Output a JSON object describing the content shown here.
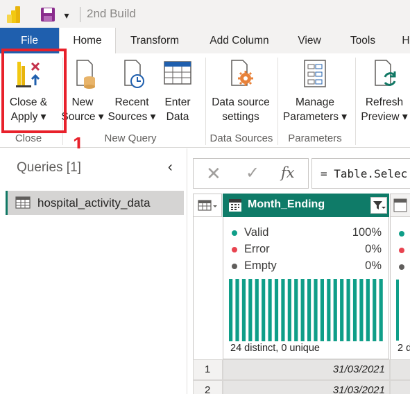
{
  "titlebar": {
    "title": "2nd Build",
    "dropdown_glyph": "▾",
    "icons": [
      "powerbi-logo-icon",
      "save-icon",
      "chevron-down-icon"
    ]
  },
  "tabs": [
    {
      "label": "File"
    },
    {
      "label": "Home"
    },
    {
      "label": "Transform"
    },
    {
      "label": "Add Column"
    },
    {
      "label": "View"
    },
    {
      "label": "Tools"
    },
    {
      "label": "H"
    }
  ],
  "ribbon": {
    "close_apply": {
      "line1": "Close &",
      "line2": "Apply ▾"
    },
    "new_source": {
      "line1": "New",
      "line2": "Source ▾"
    },
    "recent_sources": {
      "line1": "Recent",
      "line2": "Sources ▾"
    },
    "enter_data": {
      "line1": "Enter",
      "line2": "Data"
    },
    "data_source_settings": {
      "line1": "Data source",
      "line2": "settings"
    },
    "manage_parameters": {
      "line1": "Manage",
      "line2": "Parameters ▾"
    },
    "refresh_preview": {
      "line1": "Refresh",
      "line2": "Preview ▾"
    },
    "groups": {
      "close": "Close",
      "new_query": "New Query",
      "data_sources": "Data Sources",
      "parameters": "Parameters"
    }
  },
  "annotation": {
    "marker": "1",
    "highlight_color": "#e8212b"
  },
  "queries": {
    "header": "Queries [1]",
    "collapse_glyph": "‹",
    "items": [
      {
        "label": "hospital_activity_data"
      }
    ]
  },
  "formula_bar": {
    "cancel_glyph": "✕",
    "commit_glyph": "✓",
    "fx_glyph": "fx",
    "formula": "= Table.Selec"
  },
  "grid": {
    "column": {
      "name": "Month_Ending"
    },
    "quality": {
      "valid": {
        "label": "Valid",
        "value": "100%",
        "color": "#0f9e88"
      },
      "error": {
        "label": "Error",
        "value": "0%",
        "color": "#e8434f"
      },
      "empty": {
        "label": "Empty",
        "value": "0%",
        "color": "#605e5c"
      }
    },
    "distribution": {
      "bar_count": 24,
      "bar_color": "#0f9e88"
    },
    "distinct_label": "24 distinct, 0 unique",
    "column2_distinct_label": "2 d",
    "rows": [
      {
        "num": "1",
        "value": "31/03/2021"
      },
      {
        "num": "2",
        "value": "31/03/2021"
      }
    ]
  }
}
